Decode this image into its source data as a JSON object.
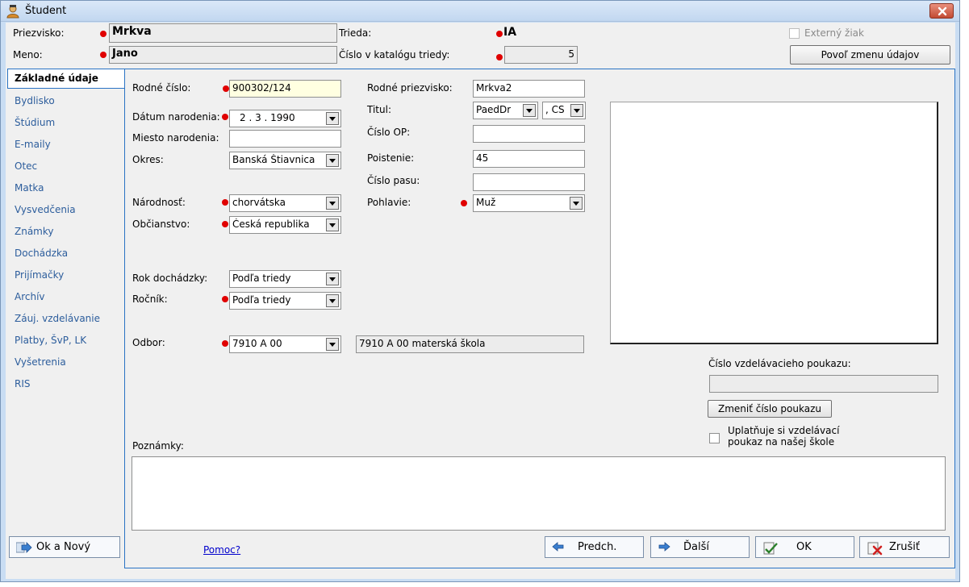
{
  "window": {
    "title": "Študent"
  },
  "header": {
    "surname_label": "Priezvisko:",
    "surname_value": "Mrkva",
    "name_label": "Meno:",
    "name_value": "Jano",
    "class_label": "Trieda:",
    "class_value": "IA",
    "catalog_label": "Číslo v katalógu triedy:",
    "catalog_value": "5",
    "external_label": "Externý žiak",
    "allow_edit_label": "Povoľ zmenu údajov"
  },
  "sidebar": {
    "items": [
      {
        "label": "Základné údaje"
      },
      {
        "label": "Bydlisko"
      },
      {
        "label": "Štúdium"
      },
      {
        "label": "E-maily"
      },
      {
        "label": "Otec"
      },
      {
        "label": "Matka"
      },
      {
        "label": "Vysvedčenia"
      },
      {
        "label": "Známky"
      },
      {
        "label": "Dochádzka"
      },
      {
        "label": "Prijímačky"
      },
      {
        "label": "Archív"
      },
      {
        "label": "Záuj. vzdelávanie"
      },
      {
        "label": "Platby, ŠvP, LK"
      },
      {
        "label": "Vyšetrenia"
      },
      {
        "label": "RIS"
      }
    ]
  },
  "form": {
    "birth_number_label": "Rodné číslo:",
    "birth_number_value": "900302/124",
    "birth_date_label": "Dátum narodenia:",
    "birth_date_value": "2 .   3 .  1990",
    "birth_place_label": "Miesto narodenia:",
    "birth_place_value": "",
    "district_label": "Okres:",
    "district_value": "Banská Štiavnica",
    "nationality_label": "Národnosť:",
    "nationality_value": "chorvátska",
    "citizenship_label": "Občianstvo:",
    "citizenship_value": "Česká republika",
    "attendance_year_label": "Rok dochádzky:",
    "attendance_year_value": "Podľa triedy",
    "grade_label": "Ročník:",
    "grade_value": "Podľa triedy",
    "field_label": "Odbor:",
    "field_value": "7910 A 00",
    "field_desc": "7910 A 00 materská škola",
    "maiden_name_label": "Rodné priezvisko:",
    "maiden_name_value": "Mrkva2",
    "title_label": "Titul:",
    "title_value": "PaedDr",
    "title_suffix_value": ", CS",
    "id_card_label": "Číslo OP:",
    "id_card_value": "",
    "insurance_label": "Poistenie:",
    "insurance_value": "45",
    "passport_label": "Číslo pasu:",
    "passport_value": "",
    "gender_label": "Pohlavie:",
    "gender_value": "Muž",
    "voucher_label": "Číslo vzdelávacieho poukazu:",
    "voucher_value": "",
    "change_voucher_label": "Zmeniť číslo poukazu",
    "voucher_check_line1": "Uplatňuje si vzdelávací",
    "voucher_check_line2": "poukaz na našej škole",
    "notes_label": "Poznámky:",
    "notes_value": ""
  },
  "footer": {
    "ok_new_label": "Ok a Nový",
    "help_label": "Pomoc?",
    "prev_label": "Predch.",
    "next_label": "Ďalší",
    "ok_label": "OK",
    "cancel_label": "Zrušiť"
  },
  "colors": {
    "required_dot": "#e00000",
    "accent_border": "#2a73c4",
    "link": "#0000cc"
  }
}
